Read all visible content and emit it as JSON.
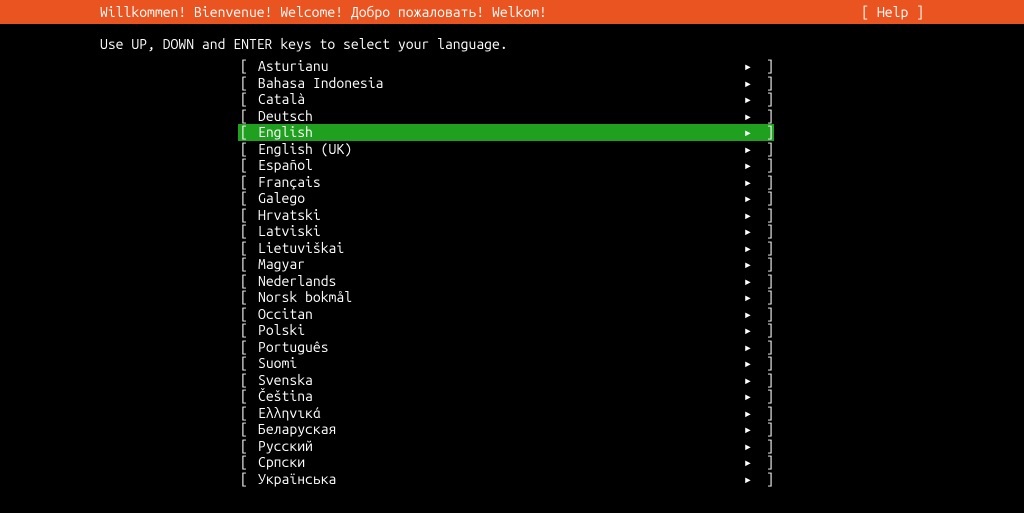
{
  "header": {
    "title": "Willkommen! Bienvenue! Welcome! Добро пожаловать! Welkom!",
    "help": "[ Help ]"
  },
  "instruction": "Use UP, DOWN and ENTER keys to select your language.",
  "brackets": {
    "open": "[",
    "close": "]"
  },
  "arrow": "▸",
  "selected_index": 4,
  "languages": [
    {
      "label": "Asturianu"
    },
    {
      "label": "Bahasa Indonesia"
    },
    {
      "label": "Català"
    },
    {
      "label": "Deutsch"
    },
    {
      "label": "English"
    },
    {
      "label": "English (UK)"
    },
    {
      "label": "Español"
    },
    {
      "label": "Français"
    },
    {
      "label": "Galego"
    },
    {
      "label": "Hrvatski"
    },
    {
      "label": "Latviski"
    },
    {
      "label": "Lietuviškai"
    },
    {
      "label": "Magyar"
    },
    {
      "label": "Nederlands"
    },
    {
      "label": "Norsk bokmål"
    },
    {
      "label": "Occitan"
    },
    {
      "label": "Polski"
    },
    {
      "label": "Português"
    },
    {
      "label": "Suomi"
    },
    {
      "label": "Svenska"
    },
    {
      "label": "Čeština"
    },
    {
      "label": "Ελληνικά"
    },
    {
      "label": "Беларуская"
    },
    {
      "label": "Русский"
    },
    {
      "label": "Српски"
    },
    {
      "label": "Українська"
    }
  ]
}
